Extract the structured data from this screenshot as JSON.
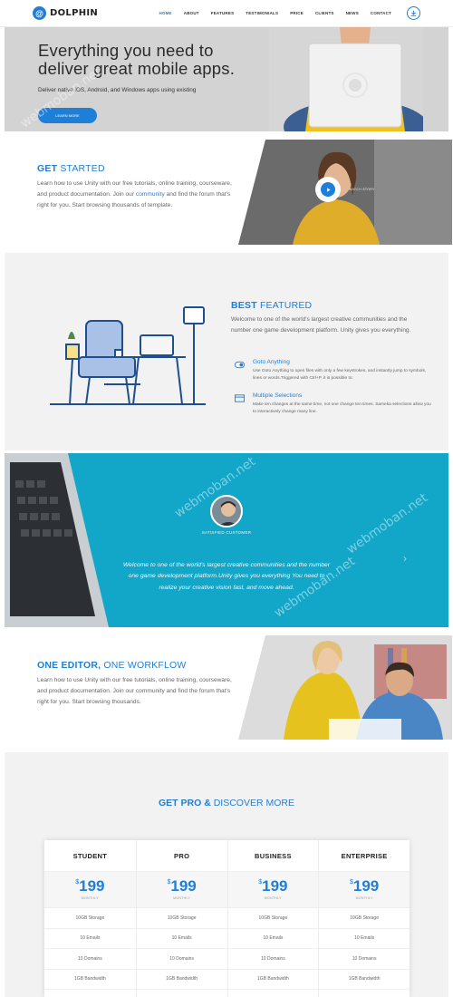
{
  "nav": {
    "logo": "DOLPHIN",
    "items": [
      {
        "label": "HOME",
        "active": true
      },
      {
        "label": "ABOUT"
      },
      {
        "label": "FEATURES"
      },
      {
        "label": "TESTIMONIALS"
      },
      {
        "label": "PRICE"
      },
      {
        "label": "CLIENTS"
      },
      {
        "label": "NEWS"
      },
      {
        "label": "CONTACT"
      }
    ],
    "download_icon": "download-icon"
  },
  "hero": {
    "title_line1": "Everything you need to",
    "title_line2": "deliver great mobile apps.",
    "subtitle": "Deliver native iOS, Android, and Windows apps using existing",
    "cta": "LEARN MORE"
  },
  "get_started": {
    "title_bold": "GET",
    "title_light": "STARTED",
    "text_before": "Learn how to use Unity with our free tutorials, online training, courseware, and product documentation. Join our",
    "link": "community",
    "text_after": "and find the forum that's right for you. Start browsing thousands of template.",
    "video_label": "WATCH STORY"
  },
  "best_featured": {
    "title_bold": "BEST",
    "title_light": "FEATURED",
    "intro": "Welcome to one of the world's largest creative communities and the number one game development platform. Unity gives you everything.",
    "features": [
      {
        "title": "Goto Anything",
        "desc": "Use Goto Anything to open files with only a few keystrokes, and instantly jump to symbols, lines or words.Triggered with Ctrl+P, it is possible to:",
        "icon": "toggle-icon"
      },
      {
        "title": "Multiple Selections",
        "desc": "Make ten changes at the same time, not one change ten times. Sameka selections allow you to interactively change many line.",
        "icon": "window-icon"
      }
    ]
  },
  "testimonial": {
    "role": "SATISFIED CUSTOMER",
    "quote": "Welcome to one of the world's largest creative communities and the number one game development platform.Unity gives you everything You need to realize your creative vision fast, and move ahead."
  },
  "one_editor": {
    "title_bold": "ONE EDITOR,",
    "title_light": "ONE WORKFLOW",
    "text": "Learn how to use Unity with our free tutorials, online training, courseware, and product documentation. Join our community and find the forum that's right for you. Start browsing thousands."
  },
  "pricing": {
    "title_bold": "GET PRO &",
    "title_light": "DISCOVER MORE",
    "plans": [
      {
        "name": "STUDENT",
        "currency": "$",
        "price": "199",
        "period": "MONTHLY",
        "features": [
          "10GB Storage",
          "10 Emails",
          "10 Domains",
          "1GB Bandwidth"
        ]
      },
      {
        "name": "PRO",
        "currency": "$",
        "price": "199",
        "period": "MONTHLY",
        "features": [
          "10GB Storage",
          "10 Emails",
          "10 Domains",
          "1GB Bandwidth"
        ]
      },
      {
        "name": "BUSINESS",
        "currency": "$",
        "price": "199",
        "period": "MONTHLY",
        "features": [
          "10GB Storage",
          "10 Emails",
          "10 Domains",
          "1GB Bandwidth"
        ]
      },
      {
        "name": "ENTERPRISE",
        "currency": "$",
        "price": "199",
        "period": "MONTHLY",
        "features": [
          "10GB Storage",
          "10 Emails",
          "10 Domains",
          "1GB Bandwidth"
        ]
      }
    ]
  },
  "watermark": "webmoban.net",
  "colors": {
    "accent": "#1e7fd9",
    "testimonial_bg": "#12a6c9",
    "section_gray": "#f2f2f2"
  }
}
